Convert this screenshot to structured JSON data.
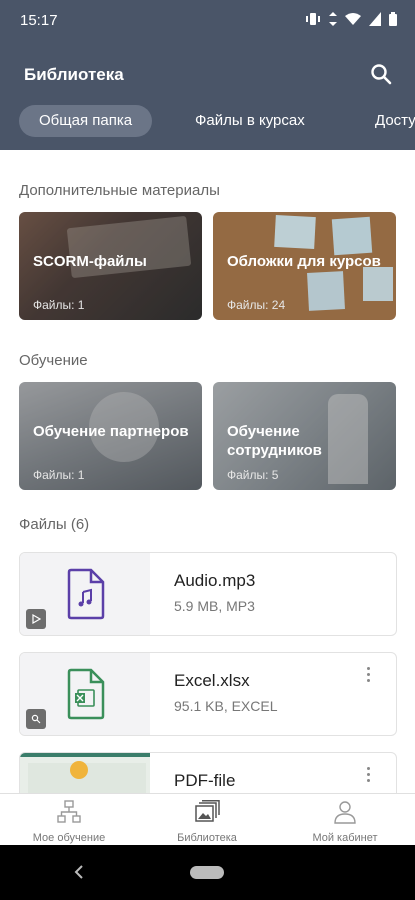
{
  "status_bar": {
    "time": "15:17"
  },
  "header": {
    "title": "Библиотека"
  },
  "tabs": [
    {
      "label": "Общая папка",
      "active": true
    },
    {
      "label": "Файлы в курсах",
      "active": false
    },
    {
      "label": "Досту",
      "active": false
    }
  ],
  "sections": {
    "extra": {
      "title": "Дополнительные материалы"
    },
    "training": {
      "title": "Обучение"
    },
    "files": {
      "title": "Файлы (6)"
    }
  },
  "folders": [
    {
      "name": "SCORM-файлы",
      "count": "Файлы: 1"
    },
    {
      "name": "Обложки для курсов",
      "count": "Файлы: 24"
    },
    {
      "name": "Обучение партнеров",
      "count": "Файлы: 1"
    },
    {
      "name": "Обучение сотрудников",
      "count": "Файлы: 5"
    }
  ],
  "files": [
    {
      "name": "Audio.mp3",
      "meta": "5.9 MB, MP3",
      "icon": "audio-file-icon"
    },
    {
      "name": "Excel.xlsx",
      "meta": "95.1 KB, EXCEL",
      "icon": "excel-file-icon"
    },
    {
      "name": "PDF-file",
      "meta": "",
      "icon": "pdf-thumbnail"
    }
  ],
  "bottom_nav": [
    {
      "label": "Мое обучение",
      "icon": "learning-icon"
    },
    {
      "label": "Библиотека",
      "icon": "library-icon",
      "active": true
    },
    {
      "label": "Мой кабинет",
      "icon": "profile-icon"
    }
  ],
  "colors": {
    "header": "#4a5568",
    "active_tab": "#6b7587",
    "audio": "#5b3fa8",
    "excel": "#3a8f5a"
  }
}
